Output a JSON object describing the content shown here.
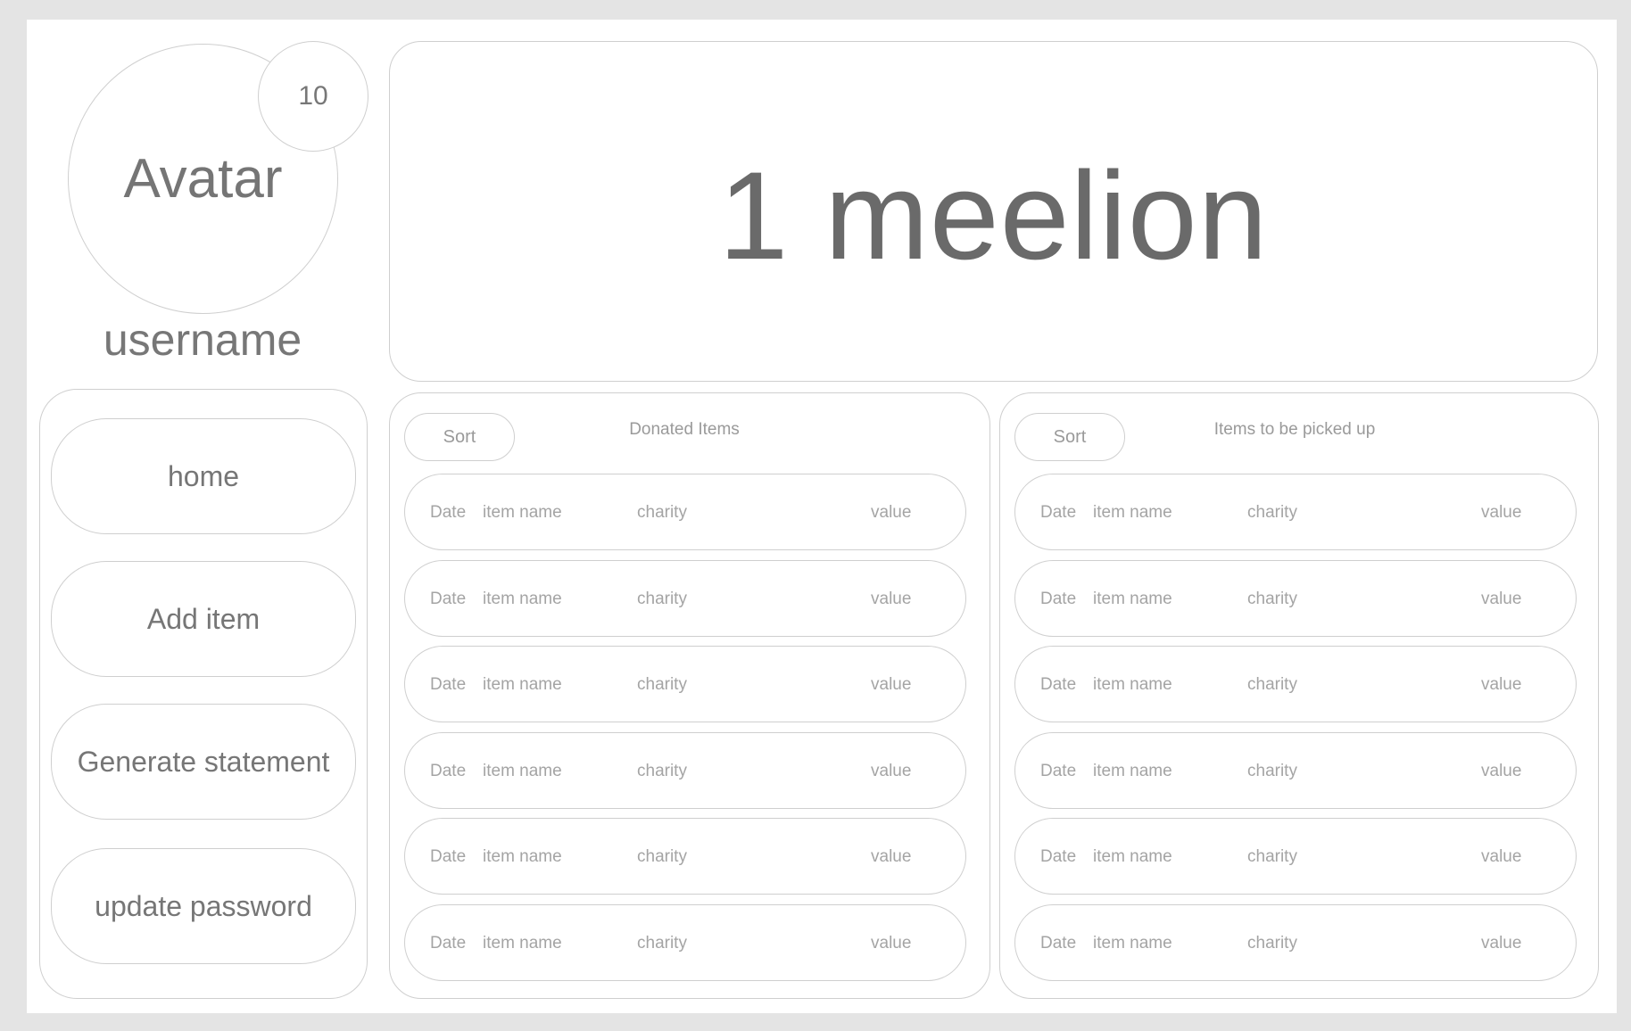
{
  "profile": {
    "avatar_label": "Avatar",
    "badge_count": "10",
    "username": "username"
  },
  "banner": {
    "text": "1 meelion"
  },
  "nav": {
    "items": [
      {
        "label": "home"
      },
      {
        "label": "Add item"
      },
      {
        "label": "Generate statement"
      },
      {
        "label": "update password"
      }
    ]
  },
  "donated": {
    "title": "Donated Items",
    "sort_label": "Sort",
    "rows": [
      {
        "date": "Date",
        "item": "item name",
        "charity": "charity",
        "value": "value"
      },
      {
        "date": "Date",
        "item": "item name",
        "charity": "charity",
        "value": "value"
      },
      {
        "date": "Date",
        "item": "item name",
        "charity": "charity",
        "value": "value"
      },
      {
        "date": "Date",
        "item": "item name",
        "charity": "charity",
        "value": "value"
      },
      {
        "date": "Date",
        "item": "item name",
        "charity": "charity",
        "value": "value"
      },
      {
        "date": "Date",
        "item": "item name",
        "charity": "charity",
        "value": "value"
      }
    ]
  },
  "pickup": {
    "title": "Items to be picked up",
    "sort_label": "Sort",
    "rows": [
      {
        "date": "Date",
        "item": "item name",
        "charity": "charity",
        "value": "value"
      },
      {
        "date": "Date",
        "item": "item name",
        "charity": "charity",
        "value": "value"
      },
      {
        "date": "Date",
        "item": "item name",
        "charity": "charity",
        "value": "value"
      },
      {
        "date": "Date",
        "item": "item name",
        "charity": "charity",
        "value": "value"
      },
      {
        "date": "Date",
        "item": "item name",
        "charity": "charity",
        "value": "value"
      },
      {
        "date": "Date",
        "item": "item name",
        "charity": "charity",
        "value": "value"
      }
    ]
  }
}
